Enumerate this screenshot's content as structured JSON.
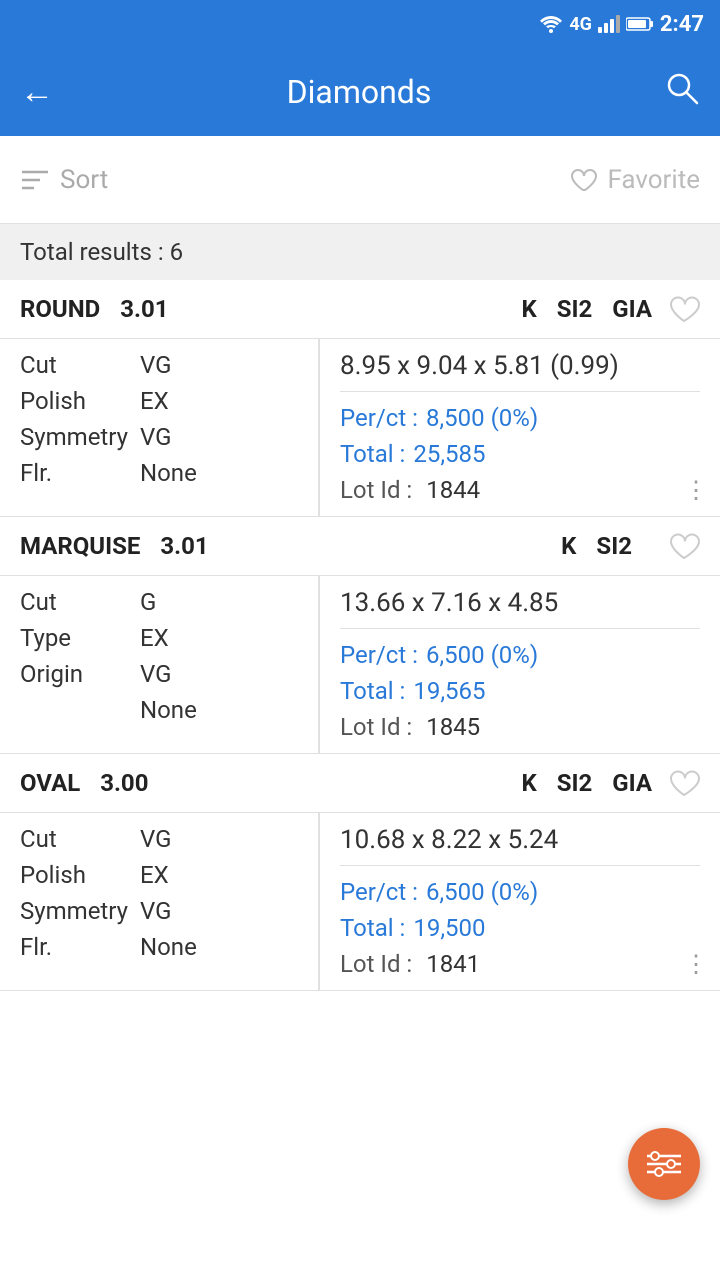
{
  "statusBar": {
    "network": "4G",
    "time": "2:47"
  },
  "appBar": {
    "title": "Diamonds",
    "backLabel": "←",
    "searchLabel": "⌕"
  },
  "toolbar": {
    "sortLabel": "Sort",
    "favoriteLabel": "Favorite"
  },
  "totalResults": "Total results : 6",
  "diamonds": [
    {
      "shape": "ROUND",
      "carat": "3.01",
      "color": "K",
      "clarity": "SI2",
      "cert": "GIA",
      "cut_label": "Cut",
      "cut_value": "VG",
      "polish_label": "Polish",
      "polish_value": "EX",
      "symmetry_label": "Symmetry",
      "symmetry_value": "VG",
      "flr_label": "Flr.",
      "flr_value": "None",
      "dimensions": "8.95  x  9.04  x  5.81  (0.99)",
      "perct_label": "Per/ct :",
      "perct_value": "8,500 (0%)",
      "total_label": "Total   :",
      "total_value": "25,585",
      "lotid_label": "Lot Id :",
      "lotid_value": "1844"
    },
    {
      "shape": "MARQUISE",
      "carat": "3.01",
      "color": "K",
      "clarity": "SI2",
      "cert": "",
      "cut_label": "Cut",
      "cut_value": "G",
      "type_label": "Type",
      "type_value": "EX",
      "origin_label": "Origin",
      "origin_value": "VG",
      "flr_label": "",
      "flr_value": "None",
      "dimensions": "13.66 x 7.16 x 4.85",
      "perct_label": "Per/ct :",
      "perct_value": "6,500 (0%)",
      "total_label": "Total   :",
      "total_value": "19,565",
      "lotid_label": "Lot Id :",
      "lotid_value": "1845"
    },
    {
      "shape": "OVAL",
      "carat": "3.00",
      "color": "K",
      "clarity": "SI2",
      "cert": "GIA",
      "cut_label": "Cut",
      "cut_value": "VG",
      "polish_label": "Polish",
      "polish_value": "EX",
      "symmetry_label": "Symmetry",
      "symmetry_value": "VG",
      "flr_label": "Flr.",
      "flr_value": "None",
      "dimensions": "10.68 x  8.22 x  5.24",
      "perct_label": "Per/ct :",
      "perct_value": "6,500 (0%)",
      "total_label": "Total   :",
      "total_value": "19,500",
      "lotid_label": "Lot Id :",
      "lotid_value": "1841"
    }
  ]
}
